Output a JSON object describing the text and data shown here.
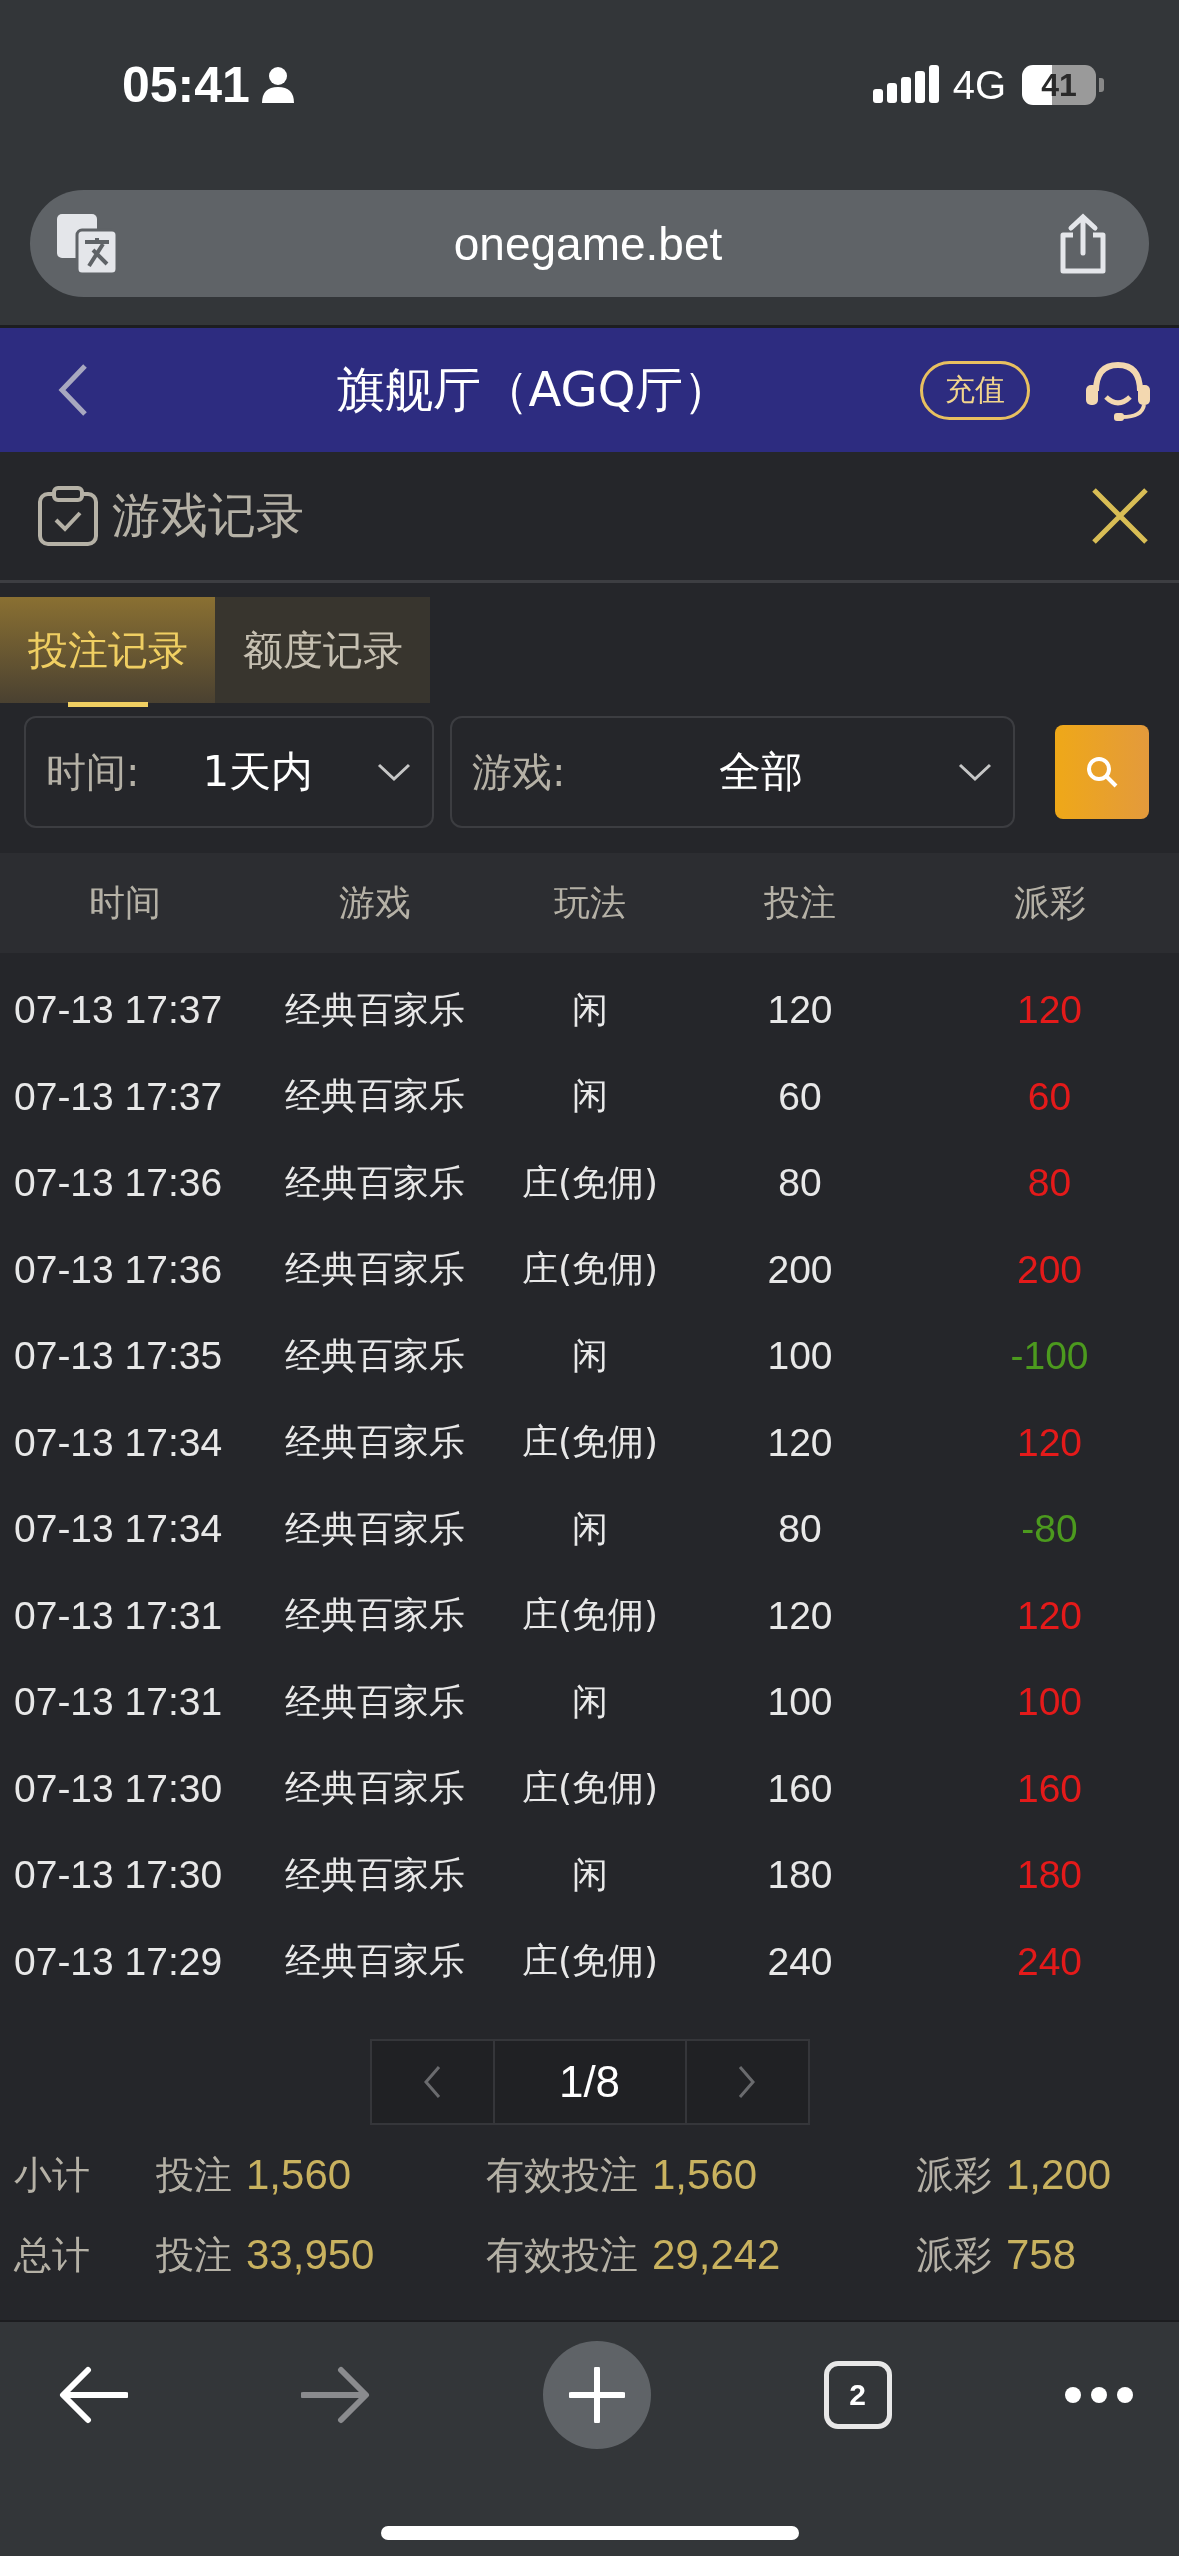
{
  "status_bar": {
    "time": "05:41",
    "network": "4G",
    "battery": "41"
  },
  "browser": {
    "url": "onegame.bet",
    "tab_count": "2"
  },
  "header": {
    "title": "旗舰厅（AGQ厅）",
    "recharge": "充值"
  },
  "panel": {
    "title": "游戏记录"
  },
  "tabs": [
    {
      "label": "投注记录",
      "selected": true
    },
    {
      "label": "额度记录",
      "selected": false
    }
  ],
  "filters": [
    {
      "label": "时间:",
      "value": "1天内"
    },
    {
      "label": "游戏:",
      "value": "全部"
    }
  ],
  "table": {
    "columns": [
      "时间",
      "游戏",
      "玩法",
      "投注",
      "派彩"
    ],
    "rows": [
      {
        "time": "07-13 17:37",
        "game": "经典百家乐",
        "play": "闲",
        "bet": "120",
        "payout": "120",
        "color": "#e41a1a"
      },
      {
        "time": "07-13 17:37",
        "game": "经典百家乐",
        "play": "闲",
        "bet": "60",
        "payout": "60",
        "color": "#e41a1a"
      },
      {
        "time": "07-13 17:36",
        "game": "经典百家乐",
        "play": "庄(免佣)",
        "bet": "80",
        "payout": "80",
        "color": "#e41a1a"
      },
      {
        "time": "07-13 17:36",
        "game": "经典百家乐",
        "play": "庄(免佣)",
        "bet": "200",
        "payout": "200",
        "color": "#e41a1a"
      },
      {
        "time": "07-13 17:35",
        "game": "经典百家乐",
        "play": "闲",
        "bet": "100",
        "payout": "-100",
        "color": "#4c9a1e"
      },
      {
        "time": "07-13 17:34",
        "game": "经典百家乐",
        "play": "庄(免佣)",
        "bet": "120",
        "payout": "120",
        "color": "#e41a1a"
      },
      {
        "time": "07-13 17:34",
        "game": "经典百家乐",
        "play": "闲",
        "bet": "80",
        "payout": "-80",
        "color": "#4c9a1e"
      },
      {
        "time": "07-13 17:31",
        "game": "经典百家乐",
        "play": "庄(免佣)",
        "bet": "120",
        "payout": "120",
        "color": "#e41a1a"
      },
      {
        "time": "07-13 17:31",
        "game": "经典百家乐",
        "play": "闲",
        "bet": "100",
        "payout": "100",
        "color": "#e41a1a"
      },
      {
        "time": "07-13 17:30",
        "game": "经典百家乐",
        "play": "庄(免佣)",
        "bet": "160",
        "payout": "160",
        "color": "#e41a1a"
      },
      {
        "time": "07-13 17:30",
        "game": "经典百家乐",
        "play": "闲",
        "bet": "180",
        "payout": "180",
        "color": "#e41a1a"
      },
      {
        "time": "07-13 17:29",
        "game": "经典百家乐",
        "play": "庄(免佣)",
        "bet": "240",
        "payout": "240",
        "color": "#e41a1a"
      }
    ]
  },
  "pagination": {
    "page": "1/8"
  },
  "summary": [
    {
      "label": "小计",
      "items": [
        {
          "label": "投注",
          "value": "1,560"
        },
        {
          "label": "有效投注",
          "value": "1,560"
        },
        {
          "label": "派彩",
          "value": "1,200"
        }
      ]
    },
    {
      "label": "总计",
      "items": [
        {
          "label": "投注",
          "value": "33,950"
        },
        {
          "label": "有效投注",
          "value": "29,242"
        },
        {
          "label": "派彩",
          "value": "758"
        }
      ]
    }
  ]
}
